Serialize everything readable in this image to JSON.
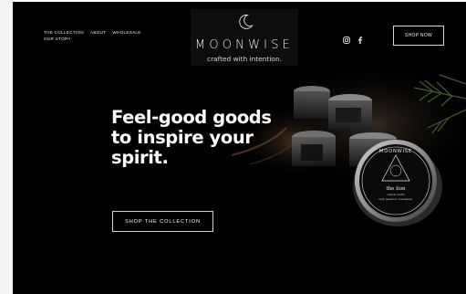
{
  "nav": {
    "items_row1": [
      "THE COLLECTION",
      "ABOUT",
      "WHOLESALE"
    ],
    "items_row2": [
      "OUR STORY"
    ]
  },
  "logo": {
    "wordmark": "MOONWISE",
    "tagline": "crafted with intention."
  },
  "social": {
    "icons": [
      "instagram-icon",
      "facebook-icon"
    ]
  },
  "header_cta": "SHOP NOW",
  "hero": {
    "headline_lines": [
      "Feel-good goods",
      "to inspire your",
      "spirit."
    ],
    "cta": "SHOP THE COLLECTION"
  },
  "product_label": {
    "brand": "MOONWISE",
    "name": "the lion",
    "sub": "natural candle",
    "desc": "loyal. generous. courageous."
  },
  "colors": {
    "background": "#000000",
    "text": "#ffffff",
    "accent_green": "#3f5a2e"
  }
}
